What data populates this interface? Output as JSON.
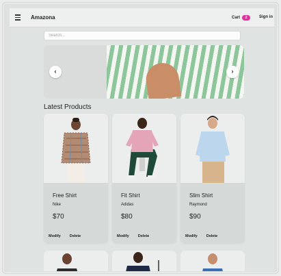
{
  "navbar": {
    "brand": "Amazona",
    "cart_label": "Cart",
    "cart_count": "2",
    "signin_label": "Sign in",
    "menu_icon": "hamburger-menu-icon"
  },
  "search": {
    "placeholder": "Search...",
    "value": ""
  },
  "carousel": {
    "prev_glyph": "‹",
    "next_glyph": "›"
  },
  "section": {
    "title": "Latest Products"
  },
  "products": [
    {
      "name": "Free Shirt",
      "brand": "Nike",
      "price": "$70",
      "modify": "Modify",
      "delete": "Delete"
    },
    {
      "name": "Fit Shirt",
      "brand": "Adidas",
      "price": "$80",
      "modify": "Modify",
      "delete": "Delete"
    },
    {
      "name": "Slim Shirt",
      "brand": "Raymond",
      "price": "$90",
      "modify": "Modify",
      "delete": "Delete"
    }
  ],
  "colors": {
    "accent_badge": "#e52f9e",
    "page_bg": "#dfe3e1",
    "card_bg": "#d5d9d7"
  }
}
